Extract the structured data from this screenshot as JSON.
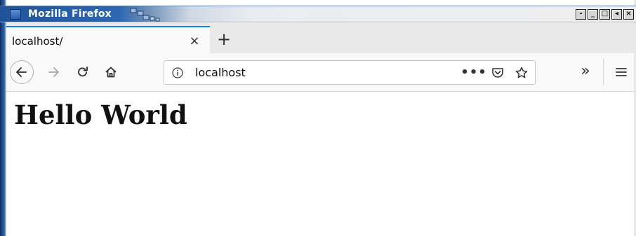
{
  "window": {
    "title": "Mozilla Firefox",
    "controls": [
      "minimize",
      "restore",
      "maximize",
      "shade",
      "close"
    ]
  },
  "tabs": [
    {
      "label": "localhost/",
      "active": true
    }
  ],
  "tab_close_glyph": "×",
  "new_tab_glyph": "+",
  "navbar": {
    "url": "localhost",
    "page_actions_glyph": "•••",
    "overflow_glyph": "»",
    "icons": [
      "back-icon",
      "forward-icon",
      "reload-icon",
      "home-icon",
      "info-icon",
      "pocket-icon",
      "bookmark-star-icon",
      "hamburger-menu-icon"
    ]
  },
  "page": {
    "heading": "Hello World"
  },
  "colors": {
    "titlebar_blue": "#2e67b1",
    "tab_accent": "#0a84ff",
    "toolbar_bg": "#f9f9fa"
  }
}
